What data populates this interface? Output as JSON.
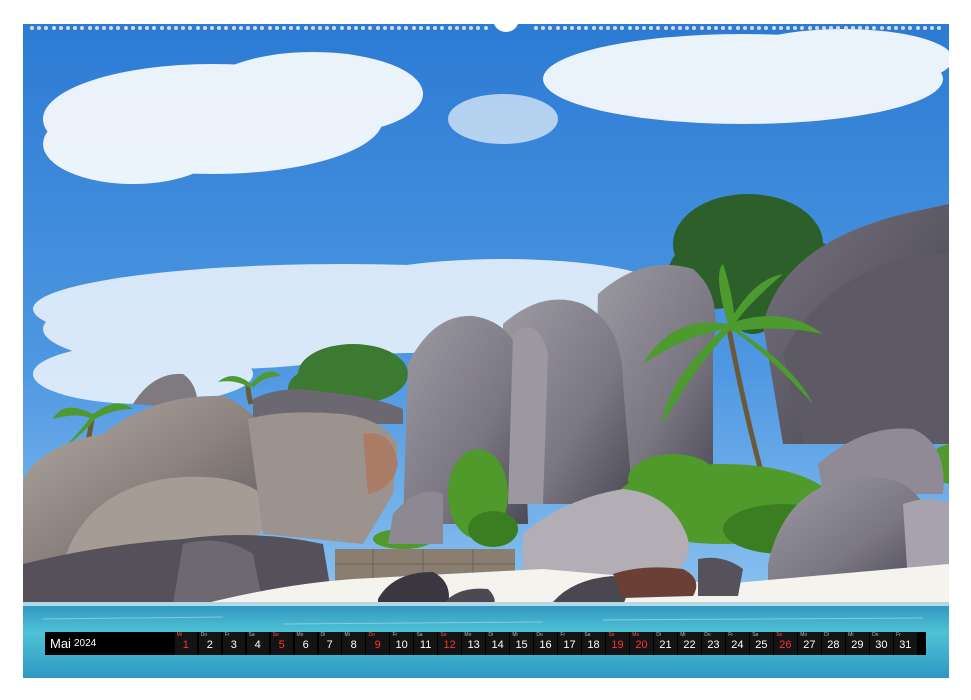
{
  "calendar": {
    "month": "Mai",
    "year": "2024",
    "highlight_color": "#e0302e",
    "days": [
      {
        "wd": "Mi",
        "num": "1",
        "red": true
      },
      {
        "wd": "Do",
        "num": "2",
        "red": false
      },
      {
        "wd": "Fr",
        "num": "3",
        "red": false
      },
      {
        "wd": "Sa",
        "num": "4",
        "red": false
      },
      {
        "wd": "So",
        "num": "5",
        "red": true
      },
      {
        "wd": "Mo",
        "num": "6",
        "red": false
      },
      {
        "wd": "Di",
        "num": "7",
        "red": false
      },
      {
        "wd": "Mi",
        "num": "8",
        "red": false
      },
      {
        "wd": "Do",
        "num": "9",
        "red": true
      },
      {
        "wd": "Fr",
        "num": "10",
        "red": false
      },
      {
        "wd": "Sa",
        "num": "11",
        "red": false
      },
      {
        "wd": "So",
        "num": "12",
        "red": true
      },
      {
        "wd": "Mo",
        "num": "13",
        "red": false
      },
      {
        "wd": "Di",
        "num": "14",
        "red": false
      },
      {
        "wd": "Mi",
        "num": "15",
        "red": false
      },
      {
        "wd": "Do",
        "num": "16",
        "red": false
      },
      {
        "wd": "Fr",
        "num": "17",
        "red": false
      },
      {
        "wd": "Sa",
        "num": "18",
        "red": false
      },
      {
        "wd": "So",
        "num": "19",
        "red": true
      },
      {
        "wd": "Mo",
        "num": "20",
        "red": true
      },
      {
        "wd": "Di",
        "num": "21",
        "red": false
      },
      {
        "wd": "Mi",
        "num": "22",
        "red": false
      },
      {
        "wd": "Do",
        "num": "23",
        "red": false
      },
      {
        "wd": "Fr",
        "num": "24",
        "red": false
      },
      {
        "wd": "Sa",
        "num": "25",
        "red": false
      },
      {
        "wd": "So",
        "num": "26",
        "red": true
      },
      {
        "wd": "Mo",
        "num": "27",
        "red": false
      },
      {
        "wd": "Di",
        "num": "28",
        "red": false
      },
      {
        "wd": "Mi",
        "num": "29",
        "red": false
      },
      {
        "wd": "Do",
        "num": "30",
        "red": false
      },
      {
        "wd": "Fr",
        "num": "31",
        "red": false
      }
    ]
  },
  "photo": {
    "subject": "granite-boulders-beach-palms",
    "colors": {
      "sky_top": "#2f7fd6",
      "sky_bottom": "#6fb2ea",
      "rock": "#8a8891",
      "rock_dark": "#4e4c55",
      "palm": "#3f8a2a",
      "sand": "#f2f1ec",
      "water": "#3fb3cf"
    }
  }
}
